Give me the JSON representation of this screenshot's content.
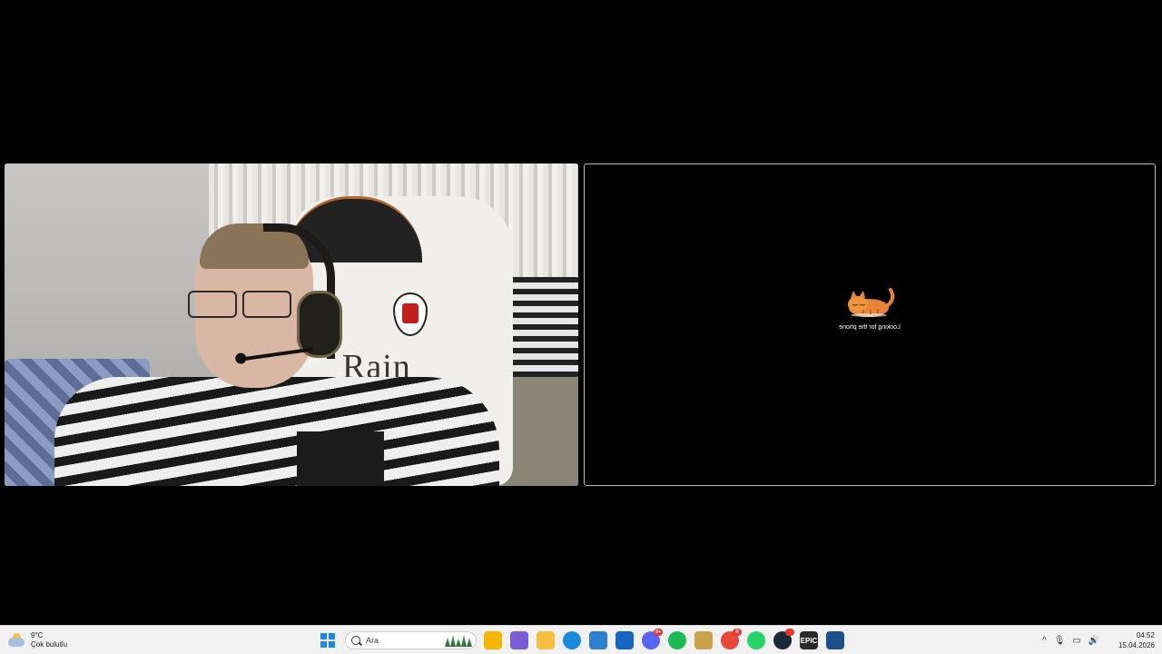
{
  "screen_share": {
    "status_text": "Looking for the phone"
  },
  "taskbar": {
    "weather": {
      "temperature": "9°C",
      "condition": "Çok bulutlu",
      "icon": "partly-cloudy-icon"
    },
    "search": {
      "placeholder": "Ara"
    },
    "apps": [
      {
        "name": "file-explorer-icon",
        "color": "#f4b400"
      },
      {
        "name": "copilot-icon",
        "color": "#7b5cd6"
      },
      {
        "name": "folder-icon",
        "color": "#f6c03f"
      },
      {
        "name": "edge-icon",
        "color": "#1b8ad8"
      },
      {
        "name": "store-icon",
        "color": "#2d7fd1"
      },
      {
        "name": "mail-icon",
        "color": "#1565c0"
      },
      {
        "name": "discord-icon",
        "color": "#5865f2",
        "badge": "9+"
      },
      {
        "name": "spotify-icon",
        "color": "#1db954"
      },
      {
        "name": "league-icon",
        "color": "#c8a34a"
      },
      {
        "name": "chrome-icon",
        "color": "#e9463a",
        "badge": "R"
      },
      {
        "name": "whatsapp-icon",
        "color": "#25d366"
      },
      {
        "name": "steam-icon",
        "color": "#1b2838",
        "badge": ""
      },
      {
        "name": "epic-games-icon",
        "color": "#2a2a2a",
        "label": "EPIC"
      },
      {
        "name": "camera-app-icon",
        "color": "#1f4e8c"
      }
    ],
    "tray": {
      "chevron": "^",
      "mic": "🎙",
      "network": "▭",
      "volume": "🔊"
    },
    "clock": {
      "time": "04:52",
      "date": "15.04.2026"
    }
  }
}
